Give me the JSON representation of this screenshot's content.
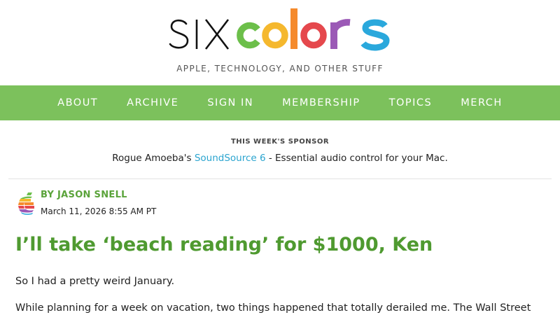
{
  "site": {
    "logo_text": "sixcolors",
    "logo_colors": {
      "six": "#111111",
      "c": "#6cbf4a",
      "o1": "#f5b82e",
      "l": "#f58a2c",
      "o2": "#e5484d",
      "r": "#9b59b6",
      "s": "#2aa8dc"
    },
    "tagline": "APPLE, TECHNOLOGY, AND OTHER STUFF"
  },
  "nav": {
    "background": "#7cc15c",
    "items": [
      {
        "label": "ABOUT"
      },
      {
        "label": "ARCHIVE"
      },
      {
        "label": "SIGN IN"
      },
      {
        "label": "MEMBERSHIP"
      },
      {
        "label": "TOPICS"
      },
      {
        "label": "MERCH"
      }
    ]
  },
  "sponsor": {
    "heading": "THIS WEEK'S SPONSOR",
    "prefix": "Rogue Amoeba's ",
    "link": "SoundSource 6",
    "suffix": " - Essential audio control for your Mac."
  },
  "post": {
    "author_icon": "six-colors-c-icon",
    "byline": "BY JASON SNELL",
    "date": "March 11, 2026 8:55 AM PT",
    "title": "I’ll take ‘beach reading’ for $1000, Ken",
    "paragraphs": [
      "So I had a pretty weird January.",
      "While planning for a week on vacation, two things happened that totally derailed me. The Wall Street"
    ]
  }
}
